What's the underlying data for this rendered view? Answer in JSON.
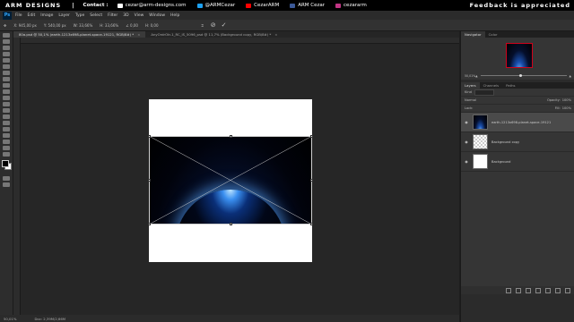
{
  "banner": {
    "brand": "ARM DESIGNS",
    "separator": "|",
    "contact_label": "Contact :",
    "email": "cezar@arm-designs.com",
    "twitter": "@ARMCezar",
    "youtube": "CezarARM",
    "facebook": "ARM Cezar",
    "instagram": "cezararm",
    "feedback": "Feedback is appreciated",
    "colors": {
      "twitter": "#1da1f2",
      "youtube": "#ff0000",
      "facebook": "#3b5998",
      "instagram": "#c13584",
      "email": "#ffffff"
    }
  },
  "menubar": {
    "app_logo": "Ps",
    "items": [
      "File",
      "Edit",
      "Image",
      "Layer",
      "Type",
      "Select",
      "Filter",
      "3D",
      "View",
      "Window",
      "Help"
    ]
  },
  "options_bar": {
    "x_label": "X:",
    "x_value": "945,00 px",
    "y_label": "Y:",
    "y_value": "540,00 px",
    "w_label": "W:",
    "w_value": "33,66%",
    "h_label": "H:",
    "h_value": "33,66%",
    "angle_value": "0,00",
    "interp": "H: 0,00",
    "cancel_icon": "cancel-icon",
    "commit_icon": "commit-icon"
  },
  "tabs": [
    {
      "label": "80a.psd @ 50,1% (earth-1213x698-planet-space-19121, RGB/8#) *",
      "active": true
    },
    {
      "label": "AnyOrdrOtr-1_RC_IS_5096_psd @ 11,7% (Background copy, RGB/8#) *",
      "active": false
    }
  ],
  "status_bar": {
    "zoom": "50,01%",
    "doc_info": "Doc: 2,39M/2,66M"
  },
  "navigator": {
    "tabs": [
      "Navigator",
      "Color"
    ],
    "zoom_out": "50,01%"
  },
  "layers_panel": {
    "tabs": [
      "Layers",
      "Channels",
      "Paths"
    ],
    "kind_label": "Kind",
    "blend_mode": "Normal",
    "opacity_label": "Opacity:",
    "opacity_value": "100%",
    "lock_label": "Lock:",
    "fill_label": "Fill:",
    "fill_value": "100%",
    "layers": [
      {
        "name": "earth-1213x698-planet-space-19121",
        "selected": true,
        "thumb": "space"
      },
      {
        "name": "Background copy",
        "selected": false,
        "thumb": "checker"
      },
      {
        "name": "Background",
        "selected": false,
        "thumb": "white"
      }
    ]
  }
}
